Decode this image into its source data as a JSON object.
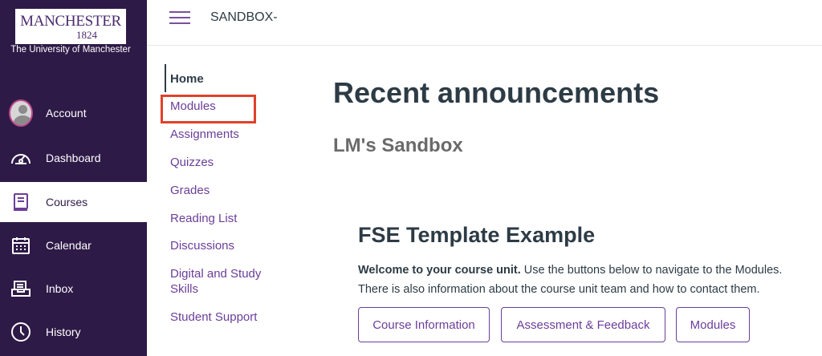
{
  "institution": {
    "logo_name": "MANCHESTER",
    "logo_year": "1824",
    "subtitle": "The University of Manchester"
  },
  "global_nav": {
    "items": [
      {
        "label": "Account",
        "icon": "account-avatar"
      },
      {
        "label": "Dashboard",
        "icon": "dashboard-gauge-icon"
      },
      {
        "label": "Courses",
        "icon": "courses-book-icon",
        "active": true
      },
      {
        "label": "Calendar",
        "icon": "calendar-icon"
      },
      {
        "label": "Inbox",
        "icon": "inbox-icon"
      },
      {
        "label": "History",
        "icon": "history-clock-icon"
      }
    ]
  },
  "header": {
    "breadcrumb": "SANDBOX-"
  },
  "course_nav": {
    "items": [
      {
        "label": "Home",
        "active": true
      },
      {
        "label": "Modules",
        "highlighted": true
      },
      {
        "label": "Assignments"
      },
      {
        "label": "Quizzes"
      },
      {
        "label": "Grades"
      },
      {
        "label": "Reading List"
      },
      {
        "label": "Discussions"
      },
      {
        "label": "Digital and Study Skills"
      },
      {
        "label": "Student Support"
      }
    ]
  },
  "main": {
    "title": "Recent announcements",
    "subtitle": "LM's Sandbox",
    "card": {
      "title": "FSE Template Example",
      "intro_bold": "Welcome to your course unit.",
      "intro_text": " Use the buttons below to navigate to the Modules.",
      "intro_line2": "There is also information about the course unit team and how to contact them.",
      "buttons": [
        "Course Information",
        "Assessment & Feedback",
        "Modules"
      ]
    }
  },
  "colors": {
    "sidebar_bg": "#2e1a47",
    "link_purple": "#6b3e99",
    "highlight_red": "#e0412a"
  }
}
